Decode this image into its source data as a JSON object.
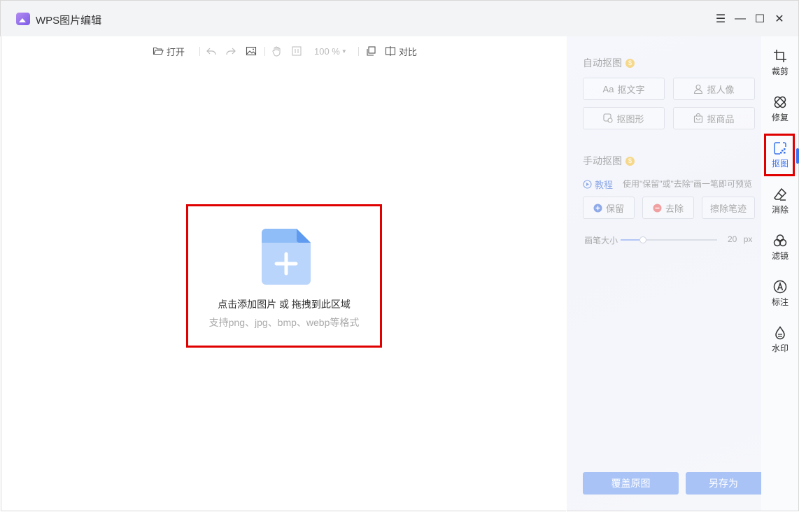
{
  "app": {
    "title": "WPS图片编辑"
  },
  "window_controls": {
    "menu": "☰",
    "minimize": "—",
    "maximize": "☐",
    "close": "✕"
  },
  "toolbar": {
    "open_label": "打开",
    "zoom": "100 %",
    "compare_label": "对比"
  },
  "drop_zone": {
    "main_text": "点击添加图片 或 拖拽到此区域",
    "sub_text": "支持png、jpg、bmp、webp等格式"
  },
  "panel": {
    "auto_title": "自动抠图",
    "auto_buttons": [
      {
        "label": "抠文字",
        "icon": "Aa"
      },
      {
        "label": "抠人像",
        "icon": "person"
      },
      {
        "label": "抠图形",
        "icon": "shape"
      },
      {
        "label": "抠商品",
        "icon": "bag"
      }
    ],
    "manual_title": "手动抠图",
    "tutorial_label": "教程",
    "tutorial_hint": "使用\"保留\"或\"去除\"画一笔即可预览",
    "keep_label": "保留",
    "remove_label": "去除",
    "erase_label": "擦除笔迹",
    "brush_label": "画笔大小",
    "brush_value": "20",
    "brush_unit": "px",
    "brush_level": 0.23,
    "cover_label": "覆盖原图",
    "saveas_label": "另存为"
  },
  "rail": [
    {
      "label": "裁剪",
      "icon": "crop-icon"
    },
    {
      "label": "修复",
      "icon": "bandage-icon"
    },
    {
      "label": "抠图",
      "icon": "cutout-icon",
      "active": true
    },
    {
      "label": "消除",
      "icon": "eraser-icon"
    },
    {
      "label": "滤镜",
      "icon": "filter-icon"
    },
    {
      "label": "标注",
      "icon": "annotate-icon"
    },
    {
      "label": "水印",
      "icon": "watermark-icon"
    }
  ],
  "colors": {
    "accent": "#3a74f0",
    "highlight": "#e00000",
    "button_disabled": "#a9c3f6"
  }
}
